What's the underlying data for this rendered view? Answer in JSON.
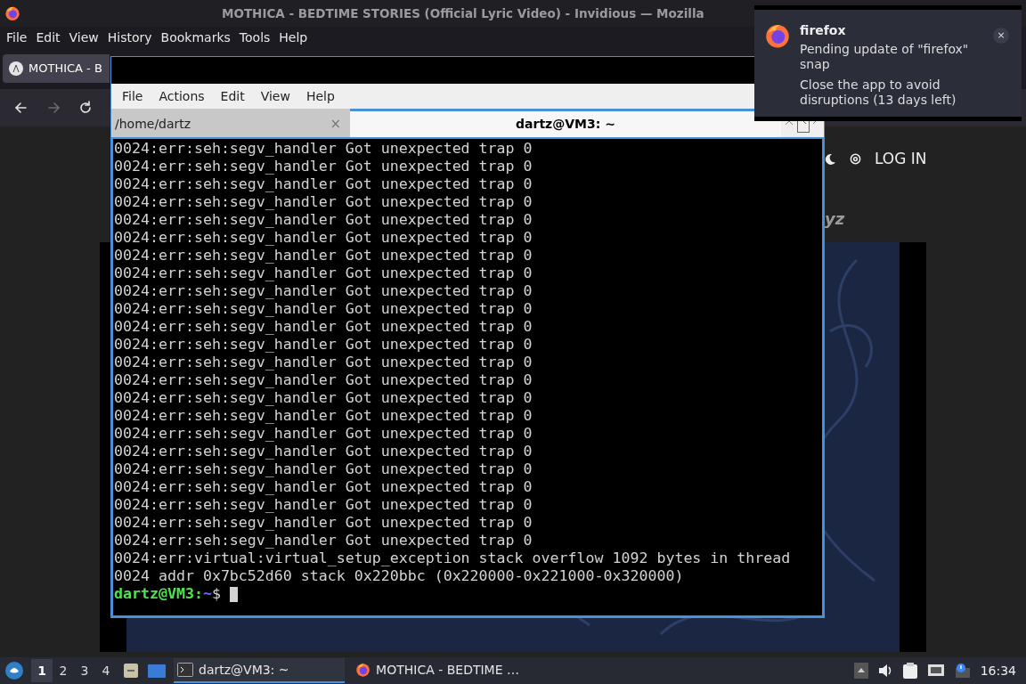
{
  "browser": {
    "title": "MOTHICA - BEDTIME STORIES (Official Lyric Video) - Invidious — Mozilla",
    "menu": [
      "File",
      "Edit",
      "View",
      "History",
      "Bookmarks",
      "Tools",
      "Help"
    ],
    "tab": {
      "label": "MOTHICA - B",
      "selected": true
    },
    "nav": [
      {
        "kind": "back",
        "disabled": false
      },
      {
        "kind": "forward",
        "disabled": true
      },
      {
        "kind": "reload",
        "disabled": false
      }
    ],
    "page": {
      "login": "LOG IN",
      "author_fragment": "yz"
    }
  },
  "terminal": {
    "menu": [
      "File",
      "Actions",
      "Edit",
      "View",
      "Help"
    ],
    "tabs": [
      {
        "label": "/home/dartz",
        "selected": false,
        "close": "×"
      },
      {
        "label": "dartz@VM3: ~",
        "selected": true
      }
    ],
    "lines": [
      "0024:err:seh:segv_handler Got unexpected trap 0",
      "0024:err:seh:segv_handler Got unexpected trap 0",
      "0024:err:seh:segv_handler Got unexpected trap 0",
      "0024:err:seh:segv_handler Got unexpected trap 0",
      "0024:err:seh:segv_handler Got unexpected trap 0",
      "0024:err:seh:segv_handler Got unexpected trap 0",
      "0024:err:seh:segv_handler Got unexpected trap 0",
      "0024:err:seh:segv_handler Got unexpected trap 0",
      "0024:err:seh:segv_handler Got unexpected trap 0",
      "0024:err:seh:segv_handler Got unexpected trap 0",
      "0024:err:seh:segv_handler Got unexpected trap 0",
      "0024:err:seh:segv_handler Got unexpected trap 0",
      "0024:err:seh:segv_handler Got unexpected trap 0",
      "0024:err:seh:segv_handler Got unexpected trap 0",
      "0024:err:seh:segv_handler Got unexpected trap 0",
      "0024:err:seh:segv_handler Got unexpected trap 0",
      "0024:err:seh:segv_handler Got unexpected trap 0",
      "0024:err:seh:segv_handler Got unexpected trap 0",
      "0024:err:seh:segv_handler Got unexpected trap 0",
      "0024:err:seh:segv_handler Got unexpected trap 0",
      "0024:err:seh:segv_handler Got unexpected trap 0",
      "0024:err:seh:segv_handler Got unexpected trap 0",
      "0024:err:seh:segv_handler Got unexpected trap 0",
      "0024:err:virtual:virtual_setup_exception stack overflow 1092 bytes in thread",
      "0024 addr 0x7bc52d60 stack 0x220bbc (0x220000-0x221000-0x320000)"
    ],
    "prompt": {
      "user": "dartz@VM3",
      "separator": ":",
      "path": "~",
      "symbol": "$"
    }
  },
  "notification": {
    "close": "×",
    "app": "firefox",
    "summary": "Pending update of \"firefox\" snap",
    "body": "Close the app to avoid disruptions (13 days left)"
  },
  "taskbar": {
    "workspaces": [
      {
        "label": "1",
        "selected": true
      },
      {
        "label": "2",
        "selected": false
      },
      {
        "label": "3",
        "selected": false
      },
      {
        "label": "4",
        "selected": false
      }
    ],
    "tasks": [
      {
        "kind": "terminal",
        "label": "dartz@VM3: ~",
        "selected": true
      },
      {
        "kind": "browser",
        "label": "MOTHICA - BEDTIME …",
        "selected": false
      }
    ],
    "clock": "16:34"
  }
}
